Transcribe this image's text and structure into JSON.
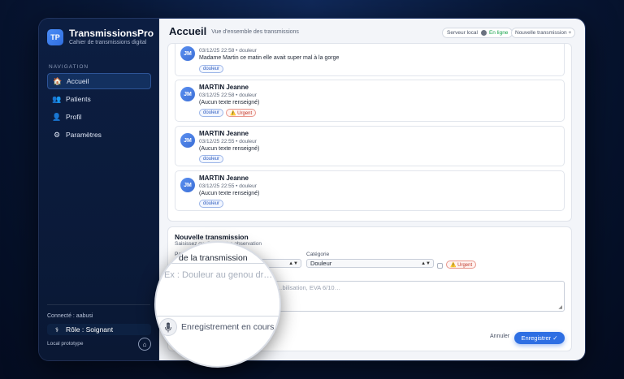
{
  "sidebar": {
    "logo": "TP",
    "app_name": "TransmissionsPro",
    "app_subtitle": "Cahier de transmissions digital",
    "nav_title": "NAVIGATION",
    "items": [
      {
        "label": "Accueil",
        "icon": "home-icon",
        "active": true
      },
      {
        "label": "Patients",
        "icon": "users-icon",
        "active": false
      },
      {
        "label": "Profil",
        "icon": "user-icon",
        "active": false
      },
      {
        "label": "Paramètres",
        "icon": "gear-icon",
        "active": false
      }
    ],
    "connected": "Connecté : aabusi",
    "role": "Rôle : Soignant",
    "local": "Local prototype"
  },
  "header": {
    "title": "Accueil",
    "subtitle": "Vue d'ensemble des transmissions",
    "server_label": "Serveur local",
    "server_status": "En ligne",
    "new_button": "Nouvelle transmission +"
  },
  "transmissions": [
    {
      "initials": "JM",
      "name": "",
      "meta": "03/12/25 22:58 • douleur",
      "text": "Madame Martin ce matin elle avait super mal à la gorge",
      "tags": [
        "douleur"
      ],
      "urgent": false
    },
    {
      "initials": "JM",
      "name": "MARTIN Jeanne",
      "meta": "03/12/25 22:58 • douleur",
      "text": "(Aucun texte renseigné)",
      "tags": [
        "douleur"
      ],
      "urgent": true
    },
    {
      "initials": "JM",
      "name": "MARTIN Jeanne",
      "meta": "03/12/25 22:55 • douleur",
      "text": "(Aucun texte renseigné)",
      "tags": [
        "douleur"
      ],
      "urgent": false
    },
    {
      "initials": "JM",
      "name": "MARTIN Jeanne",
      "meta": "03/12/25 22:55 • douleur",
      "text": "(Aucun texte renseigné)",
      "tags": [
        "douleur"
      ],
      "urgent": false
    }
  ],
  "urgent_label": "⚠️ Urgent",
  "form": {
    "title": "Nouvelle transmission",
    "subtitle": "Saisissez ou dictez votre observation",
    "patient_label": "Patient",
    "category_label": "Catégorie",
    "category_value": "Douleur",
    "textarea_placeholder": "…bilisation, EVA 6/10…",
    "cancel": "Annuler",
    "save": "Enregistrer ✓"
  },
  "magnifier": {
    "label": "de la transmission",
    "placeholder": "Ex : Douleur au genou dr…",
    "recording": "Enregistrement en cours…"
  },
  "colors": {
    "accent": "#2e6fe3",
    "sidebar_bg": "#0c1e42",
    "online": "#16a34a",
    "urgent": "#c0392b"
  }
}
